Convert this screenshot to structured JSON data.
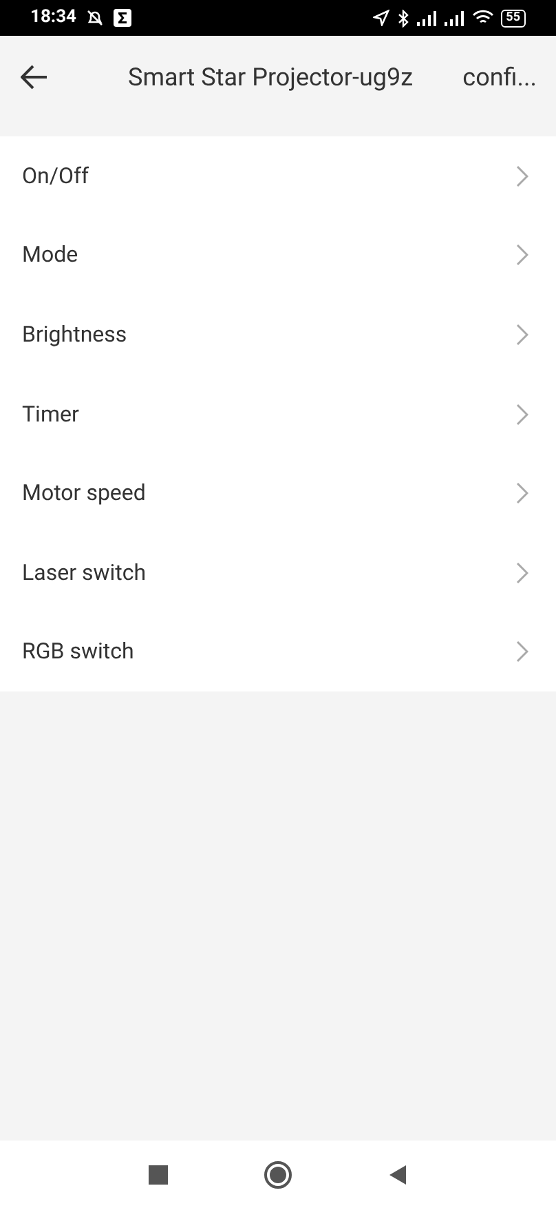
{
  "status_bar": {
    "time": "18:34",
    "battery": "55"
  },
  "header": {
    "title": "Smart Star Projector-ug9z",
    "action": "confi..."
  },
  "menu": [
    {
      "label": "On/Off"
    },
    {
      "label": "Mode"
    },
    {
      "label": "Brightness"
    },
    {
      "label": "Timer"
    },
    {
      "label": "Motor speed"
    },
    {
      "label": "Laser switch"
    },
    {
      "label": "RGB switch"
    }
  ]
}
